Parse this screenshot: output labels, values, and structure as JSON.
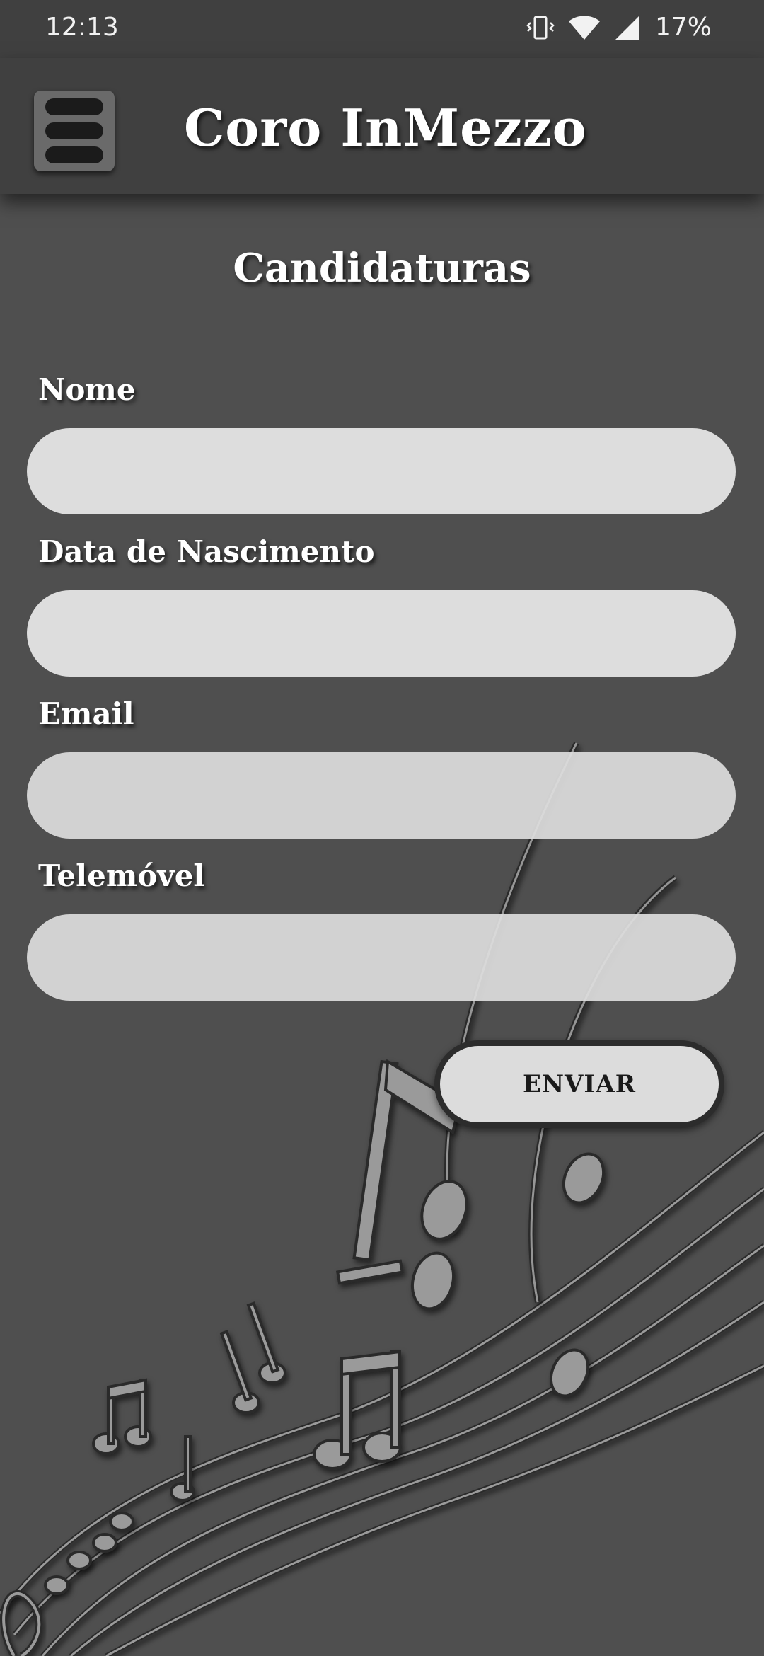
{
  "status_bar": {
    "time": "12:13",
    "battery": "17%"
  },
  "app_bar": {
    "title": "Coro InMezzo",
    "menu_icon": "hamburger-menu-icon"
  },
  "page": {
    "title": "Candidaturas"
  },
  "form": {
    "fields": [
      {
        "label": "Nome",
        "value": ""
      },
      {
        "label": "Data de Nascimento",
        "value": ""
      },
      {
        "label": "Email",
        "value": ""
      },
      {
        "label": "Telemóvel",
        "value": ""
      }
    ],
    "submit_label": "ENVIAR"
  },
  "colors": {
    "background": "#4f4f4f",
    "app_bar": "#404040",
    "input": "#dddddd"
  }
}
